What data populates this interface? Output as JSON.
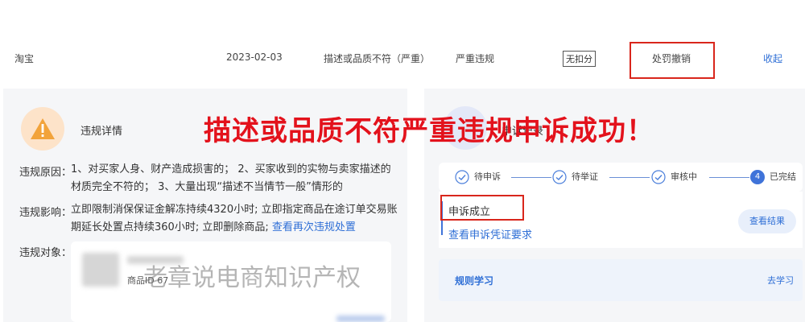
{
  "record": {
    "platform": "淘宝",
    "date": "2023-02-03",
    "reason": "描述或品质不符（严重）",
    "severity": "严重违规",
    "deduction": "无扣分",
    "penalty_status": "处罚撤销",
    "collapse_link": "收起"
  },
  "banner": "描述或品质不符严重违规申诉成功！",
  "left_panel": {
    "title": "违规详情",
    "reason_label": "违规原因：",
    "reason_text": "1、对买家人身、财产造成损害的； 2、买家收到的实物与卖家描述的材质完全不符的； 3、大量出现“描述不当情节一般”情形的",
    "impact_label": "违规影响：",
    "impact_text": "立即限制消保保证金解冻持续4320小时; 立即指定商品在途订单交易账期延长处置点持续360小时; 立即删除商品; ",
    "impact_link": "查看再次违规处置",
    "object_label": "违规对象：",
    "object_item_id": "商品ID 67"
  },
  "right_panel": {
    "title": "申诉记录",
    "steps": [
      {
        "label": "待申诉"
      },
      {
        "label": "待举证"
      },
      {
        "label": "审核中"
      },
      {
        "number": "4",
        "label": "已完结"
      }
    ],
    "appeal_status": "申诉成立",
    "view_prefix": "查看",
    "view_link": "申诉凭证要求",
    "result_button": "查看结果",
    "rule_title": "规则学习",
    "rule_link": "去学习"
  },
  "watermark": "老章说电商知识产权",
  "colors": {
    "annotation_red": "#e3121c",
    "link_blue": "#2f6fd6",
    "warning_orange": "#f2a33a"
  }
}
